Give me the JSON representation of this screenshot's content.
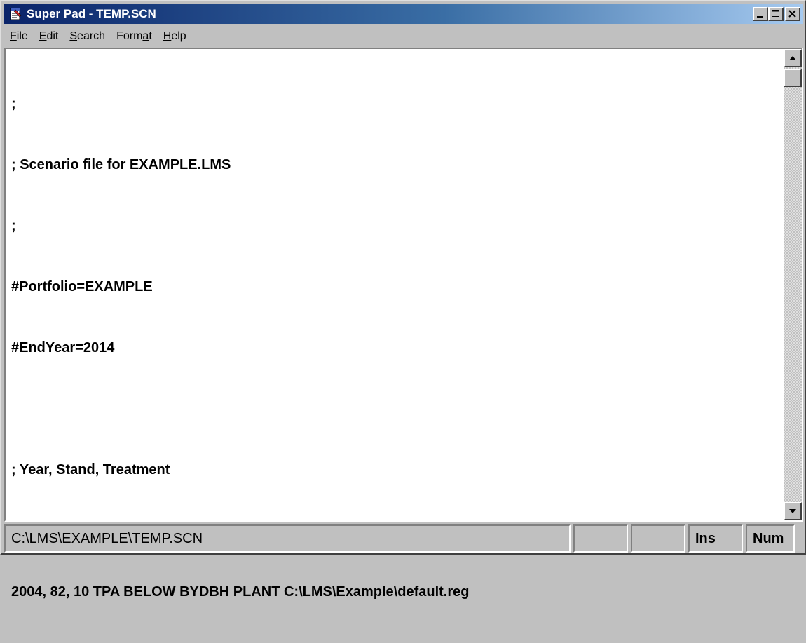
{
  "window": {
    "title": "Super Pad - TEMP.SCN",
    "icon": "notepad-icon",
    "controls": [
      "minimize-icon",
      "maximize-icon",
      "close-icon"
    ]
  },
  "menubar": {
    "items": [
      {
        "label": "File"
      },
      {
        "label": "Edit"
      },
      {
        "label": "Search"
      },
      {
        "label": "Format"
      },
      {
        "label": "Help"
      }
    ]
  },
  "editor": {
    "lines": [
      ";",
      "; Scenario file for EXAMPLE.LMS",
      ";",
      "#Portfolio=EXAMPLE",
      "#EndYear=2014",
      "",
      "; Year, Stand, Treatment",
      "",
      "2004, 82, 10 TPA BELOW BYDBH PLANT C:\\LMS\\Example\\default.reg"
    ]
  },
  "statusbar": {
    "path": "C:\\LMS\\EXAMPLE\\TEMP.SCN",
    "pane2": "",
    "pane3": "",
    "ins": "Ins",
    "num": "Num"
  },
  "colors": {
    "titlebar_start": "#0a246a",
    "titlebar_end": "#a6caf0",
    "face": "#c0c0c0"
  }
}
